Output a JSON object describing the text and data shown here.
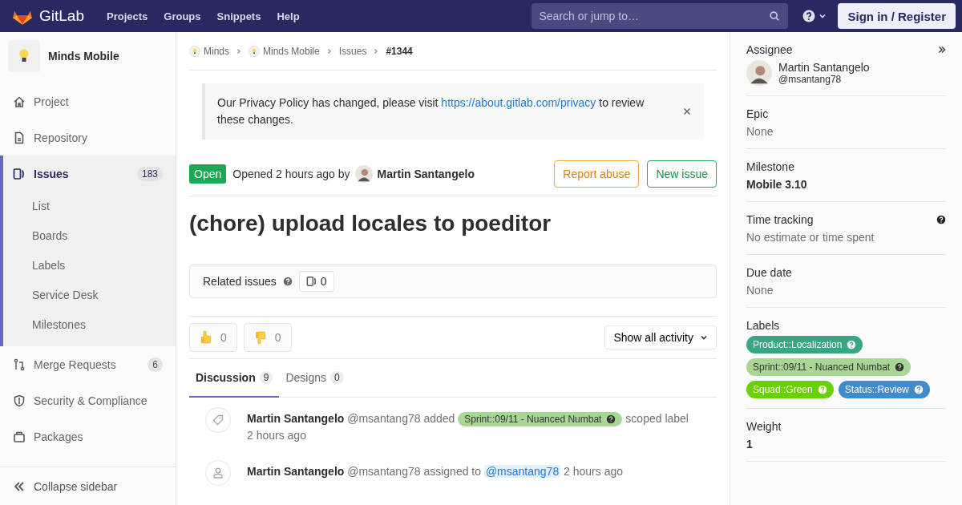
{
  "navbar": {
    "logo": "GitLab",
    "links": [
      "Projects",
      "Groups",
      "Snippets",
      "Help"
    ],
    "search": {
      "placeholder": "Search or jump to…"
    },
    "sign_in": "Sign in / Register"
  },
  "project": {
    "name": "Minds Mobile"
  },
  "nav": [
    {
      "kind": "project",
      "label": "Project",
      "selected": false
    },
    {
      "kind": "repository",
      "label": "Repository",
      "selected": false
    },
    {
      "kind": "issues",
      "label": "Issues",
      "count": "183",
      "selected": true,
      "children": [
        {
          "label": "List"
        },
        {
          "label": "Boards"
        },
        {
          "label": "Labels"
        },
        {
          "label": "Service Desk"
        },
        {
          "label": "Milestones"
        }
      ]
    },
    {
      "kind": "merge",
      "label": "Merge Requests",
      "count": "6",
      "selected": false
    },
    {
      "kind": "security",
      "label": "Security & Compliance",
      "selected": false
    },
    {
      "kind": "packages",
      "label": "Packages",
      "selected": false
    }
  ],
  "collapse": "Collapse sidebar",
  "breadcrumbs": [
    {
      "label": "Minds",
      "avatar": true
    },
    {
      "label": "Minds Mobile",
      "avatar": true
    },
    {
      "label": "Issues",
      "avatar": false
    },
    {
      "label": "#1344",
      "avatar": false
    }
  ],
  "alert": {
    "text_before": "Our Privacy Policy has changed, please visit",
    "link": "https://about.gitlab.com/privacy",
    "text_after": "to review these changes."
  },
  "issue": {
    "status": "Open",
    "opened": "Opened 2 hours ago by",
    "author": "Martin Santangelo",
    "buttons": [
      {
        "kind": "warning",
        "label": "Report abuse"
      },
      {
        "kind": "success",
        "label": "New issue"
      }
    ],
    "title": "(chore) upload locales to poeditor"
  },
  "related": {
    "label": "Related issues",
    "count": "0"
  },
  "reactions": [
    {
      "kind": "thumbs_up",
      "count": "0"
    },
    {
      "kind": "thumbs_down",
      "count": "0"
    }
  ],
  "activity_filter": "Show all activity",
  "tabs": [
    {
      "label": "Discussion",
      "count": "9",
      "selected": true
    },
    {
      "label": "Designs",
      "count": "0",
      "selected": false
    }
  ],
  "timeline": [
    {
      "kind": "label",
      "author": "Martin Santangelo",
      "handle": "@msantang78",
      "action": "added",
      "label": {
        "text": "Sprint::09/11 - Nuanced Numbat",
        "color": "#a8d695"
      },
      "suffix": "scoped label",
      "time": "2 hours ago"
    },
    {
      "kind": "assign",
      "author": "Martin Santangelo",
      "handle": "@msantang78",
      "action": "assigned to",
      "mention": "@msantang78",
      "time": "2 hours ago"
    }
  ],
  "right": {
    "assignee": {
      "title": "Assignee",
      "name": "Martin Santangelo",
      "handle": "@msantang78"
    },
    "sections": [
      {
        "kind": "muted",
        "title": "Epic",
        "value": "None"
      },
      {
        "kind": "bold",
        "title": "Milestone",
        "value": "Mobile 3.10"
      },
      {
        "kind": "help",
        "title": "Time tracking",
        "value": "No estimate or time spent"
      },
      {
        "kind": "muted",
        "title": "Due date",
        "value": "None"
      },
      {
        "kind": "labels",
        "title": "Labels",
        "labels": [
          {
            "text": "Product::Localization",
            "color": "#36a684"
          },
          {
            "text": "Sprint::09/11 - Nuanced Numbat",
            "color": "#a8d695"
          },
          {
            "text": "Squad::Green",
            "color": "#69d100"
          },
          {
            "text": "Status::Review",
            "color": "#428bca"
          }
        ]
      },
      {
        "kind": "bold",
        "title": "Weight",
        "value": "1"
      }
    ]
  }
}
